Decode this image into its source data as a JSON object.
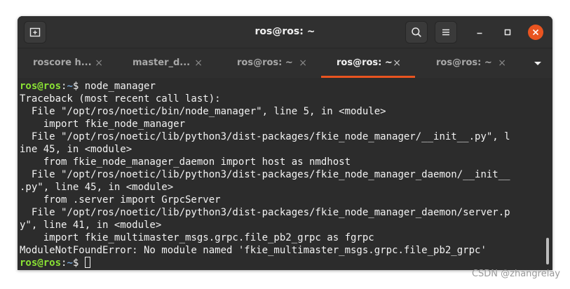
{
  "window": {
    "title": "ros@ros: ~"
  },
  "icons": {
    "new_tab": "new-tab-icon",
    "search": "search-icon",
    "menu": "hamburger-menu-icon",
    "minimize": "minimize-icon",
    "maximize": "maximize-icon",
    "close": "close-icon",
    "tab_dropdown": "chevron-down-icon"
  },
  "tabs": [
    {
      "label": "roscore h...",
      "close": "×",
      "active": false
    },
    {
      "label": "master_d...",
      "close": "×",
      "active": false
    },
    {
      "label": "ros@ros: ~",
      "close": "×",
      "active": false
    },
    {
      "label": "ros@ros: ~",
      "close": "×",
      "active": true
    },
    {
      "label": "ros@ros: ~",
      "close": "×",
      "active": false
    }
  ],
  "terminal": {
    "prompt_user": "ros@ros",
    "prompt_sep": ":",
    "prompt_path": "~",
    "prompt_dollar": "$ ",
    "command": "node_manager",
    "output": [
      "Traceback (most recent call last):",
      "  File \"/opt/ros/noetic/bin/node_manager\", line 5, in <module>",
      "    import fkie_node_manager",
      "  File \"/opt/ros/noetic/lib/python3/dist-packages/fkie_node_manager/__init__.py\", l",
      "ine 45, in <module>",
      "    from fkie_node_manager_daemon import host as nmdhost",
      "  File \"/opt/ros/noetic/lib/python3/dist-packages/fkie_node_manager_daemon/__init__",
      ".py\", line 45, in <module>",
      "    from .server import GrpcServer",
      "  File \"/opt/ros/noetic/lib/python3/dist-packages/fkie_node_manager_daemon/server.p",
      "y\", line 41, in <module>",
      "    import fkie_multimaster_msgs.grpc.file_pb2_grpc as fgrpc",
      "ModuleNotFoundError: No module named 'fkie_multimaster_msgs.grpc.file_pb2_grpc'"
    ]
  },
  "colors": {
    "accent": "#e95420",
    "prompt_user": "#8ae234",
    "prompt_path": "#729fcf",
    "terminal_bg": "#2c2c2c",
    "text": "#f2f2f2"
  },
  "watermark": "CSDN @zhangrelay"
}
